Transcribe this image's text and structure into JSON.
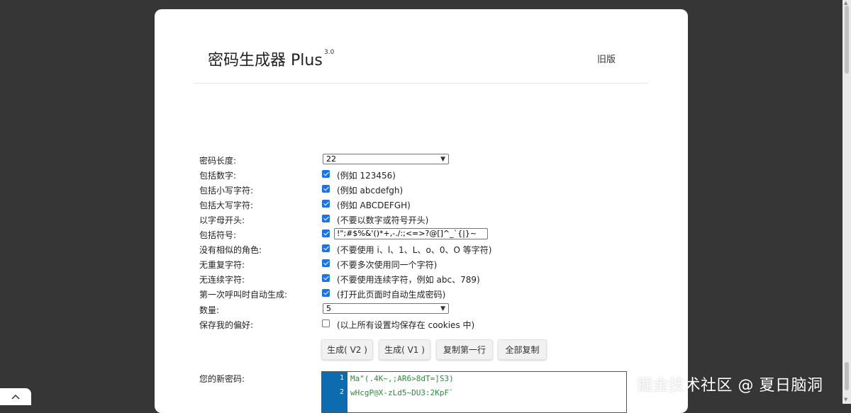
{
  "header": {
    "title": "密码生成器 Plus",
    "version": "3.0",
    "old_version_link": "旧版"
  },
  "form": {
    "length": {
      "label": "密码长度:",
      "value": "22"
    },
    "include_numbers": {
      "label": "包括数字:",
      "checked": true,
      "hint": "(例如 123456)"
    },
    "include_lowercase": {
      "label": "包括小写字符:",
      "checked": true,
      "hint": "(例如 abcdefgh)"
    },
    "include_uppercase": {
      "label": "包括大写字符:",
      "checked": true,
      "hint": "(例如 ABCDEFGH)"
    },
    "start_with_letter": {
      "label": "以字母开头:",
      "checked": true,
      "hint": "(不要以数字或符号开头)"
    },
    "include_symbols": {
      "label": "包括符号:",
      "checked": true,
      "value": "!\";#$%&'()*+,-./:;<=>?@[]^_`{|}~"
    },
    "no_similar": {
      "label": "没有相似的角色:",
      "checked": true,
      "hint": "(不要使用 i、l、1、L、o、0、O 等字符)"
    },
    "no_duplicate": {
      "label": "无重复字符:",
      "checked": true,
      "hint": "(不要多次使用同一个字符)"
    },
    "no_sequential": {
      "label": "无连续字符:",
      "checked": true,
      "hint": "(不要使用连续字符，例如 abc、789)"
    },
    "auto_generate": {
      "label": "第一次呼叫时自动生成:",
      "checked": true,
      "hint": "(打开此页面时自动生成密码)"
    },
    "quantity": {
      "label": "数量:",
      "value": "5"
    },
    "save_preferences": {
      "label": "保存我的偏好:",
      "checked": false,
      "hint": "(以上所有设置均保存在 cookies 中)"
    }
  },
  "buttons": {
    "generate_v2": "生成( V2 )",
    "generate_v1": "生成( V1 )",
    "copy_first": "复制第一行",
    "copy_all": "全部复制"
  },
  "result": {
    "label": "您的新密码:",
    "lines": [
      {
        "n": "1",
        "text": "Ma\"(.4K~,;AR6>8dT=]S3)"
      },
      {
        "n": "2",
        "text": "wHcgP@X-zLd5~DU3:2KpF`"
      }
    ]
  },
  "watermark": "掘金技术社区 @ 夏日脑洞",
  "colors": {
    "page_bg": "#363636",
    "checkbox": "#1a73e8",
    "gutter": "#0d6bb0",
    "code_text": "#2e8b3d"
  }
}
